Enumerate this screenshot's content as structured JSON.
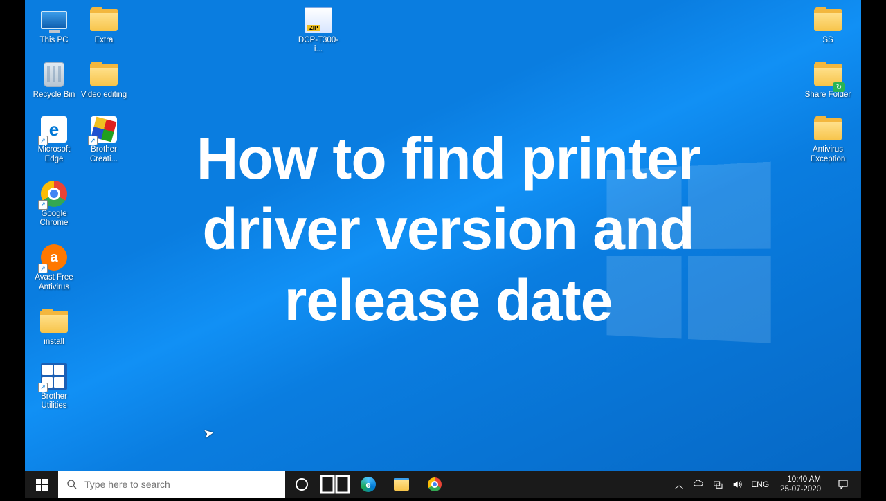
{
  "overlay_title": "How to find printer driver version and release date",
  "desktop_icons": {
    "col_left": [
      {
        "id": "this-pc",
        "label": "This PC",
        "type": "thispc",
        "shortcut": false
      },
      {
        "id": "recycle-bin",
        "label": "Recycle Bin",
        "type": "bin",
        "shortcut": false
      },
      {
        "id": "ms-edge",
        "label": "Microsoft Edge",
        "type": "edge",
        "shortcut": true
      },
      {
        "id": "chrome",
        "label": "Google Chrome",
        "type": "chrome",
        "shortcut": true
      },
      {
        "id": "avast",
        "label": "Avast Free Antivirus",
        "type": "avast",
        "shortcut": true
      },
      {
        "id": "install",
        "label": "install",
        "type": "folder",
        "shortcut": false
      },
      {
        "id": "brother-util",
        "label": "Brother Utilities",
        "type": "brutil",
        "shortcut": true
      }
    ],
    "col_left2": [
      {
        "id": "extra",
        "label": "Extra",
        "type": "folder",
        "shortcut": false
      },
      {
        "id": "video-editing",
        "label": "Video editing",
        "type": "folder",
        "shortcut": false
      },
      {
        "id": "brother-creative",
        "label": "Brother Creati...",
        "type": "brother",
        "shortcut": true
      }
    ],
    "col_mid": [
      {
        "id": "dcp-t300",
        "label": "DCP-T300-i...",
        "type": "zip",
        "shortcut": false
      }
    ],
    "col_right": [
      {
        "id": "ss",
        "label": "SS",
        "type": "folder",
        "shortcut": false
      },
      {
        "id": "share-folder",
        "label": "Share Folder",
        "type": "sharefolder",
        "shortcut": false
      },
      {
        "id": "antivirus-exc",
        "label": "Antivirus Exception",
        "type": "folder",
        "shortcut": false
      }
    ]
  },
  "taskbar": {
    "search_placeholder": "Type here to search",
    "pinned": [
      "cortana",
      "taskview",
      "edge",
      "explorer",
      "chrome"
    ],
    "tray": {
      "language": "ENG",
      "time": "10:40 AM",
      "date": "25-07-2020"
    }
  }
}
